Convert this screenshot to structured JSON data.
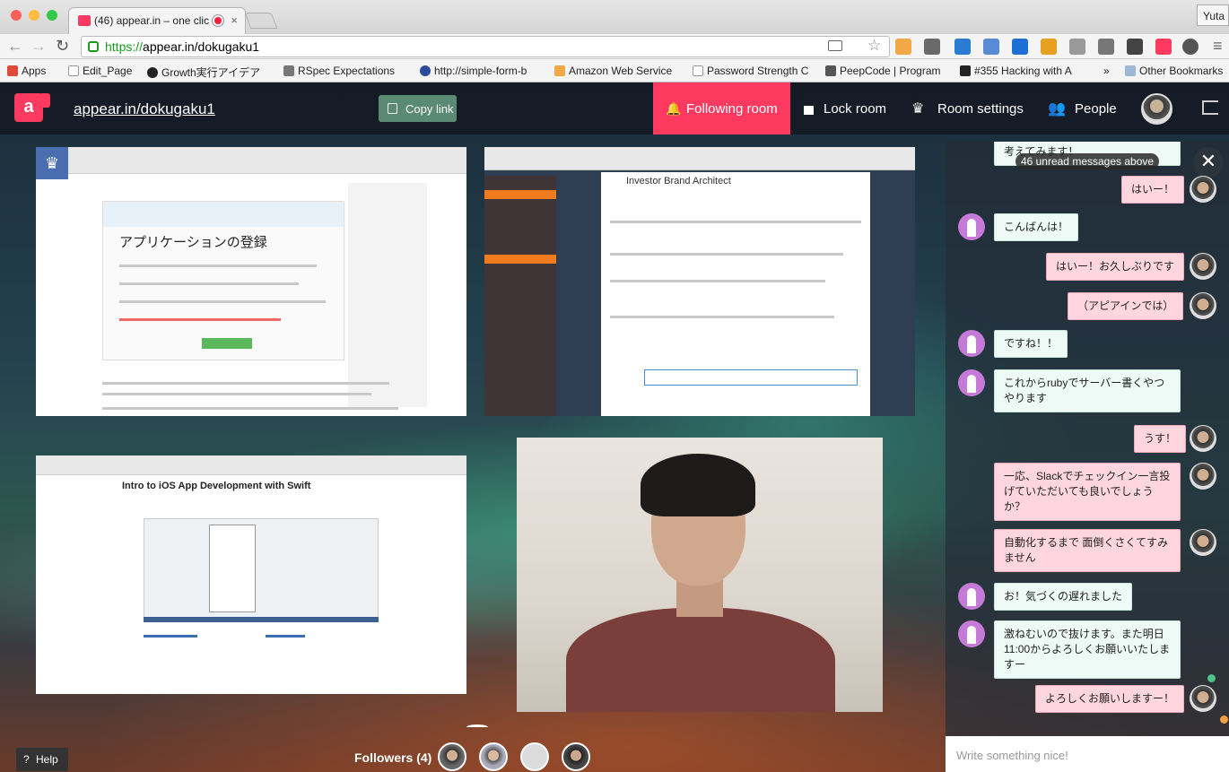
{
  "browser": {
    "tab_title": "(46) appear.in – one clic",
    "user": "Yuta",
    "url_scheme": "https://",
    "url_rest": "appear.in/dokugaku1"
  },
  "bookmarks": [
    {
      "label": "Apps",
      "icon": "apps-grid-icon"
    },
    {
      "label": "Edit_Page",
      "icon": "page-icon"
    },
    {
      "label": "Growth実行アイデア",
      "icon": "github-icon"
    },
    {
      "label": "RSpec Expectations",
      "icon": "rspec-icon"
    },
    {
      "label": "http://simple-form-b",
      "icon": "p-icon"
    },
    {
      "label": "Amazon Web Service",
      "icon": "amazon-icon"
    },
    {
      "label": "Password Strength C",
      "icon": "page-icon"
    },
    {
      "label": "PeepCode | Program",
      "icon": "peepcode-icon"
    },
    {
      "label": "#355 Hacking with A",
      "icon": "railscasts-icon"
    },
    {
      "label": "»",
      "icon": ""
    },
    {
      "label": "Other Bookmarks",
      "icon": "folder-icon"
    }
  ],
  "header": {
    "room_link": "appear.in/dokugaku1",
    "copy_link": "Copy link",
    "following_room": "Following room",
    "lock_room": "Lock room",
    "room_settings": "Room settings",
    "people": "People"
  },
  "tiles": {
    "tile1_heading": "アプリケーションの登録",
    "tile2_title": "Investor Brand Architect",
    "tile3_title": "Intro to iOS App Development with Swift"
  },
  "chat": {
    "unread": "46 unread messages above",
    "placeholder": "Write something nice!",
    "messages": [
      {
        "text": "考えてみます！",
        "dir": "in"
      },
      {
        "text": "はいー！",
        "dir": "out"
      },
      {
        "text": "こんばんは！",
        "dir": "in"
      },
      {
        "text": "はいー！お久しぶりです",
        "dir": "out"
      },
      {
        "text": "（アピアインでは）",
        "dir": "out"
      },
      {
        "text": "ですね！！",
        "dir": "in"
      },
      {
        "text": "これからrubyでサーバー書くやつやります",
        "dir": "in"
      },
      {
        "text": "うす！",
        "dir": "out"
      },
      {
        "text": "一応、Slackでチェックイン一言投げていただいても良いでしょうか？",
        "dir": "out"
      },
      {
        "text": "自動化するまで 面倒くさくてすみません",
        "dir": "out"
      },
      {
        "text": "お！気づくの遅れました",
        "dir": "in"
      },
      {
        "text": "激ねむいので抜けます。また明日11:00からよろしくお願いいたしますー",
        "dir": "in"
      },
      {
        "text": "よろしくお願いしますー！",
        "dir": "out"
      }
    ]
  },
  "footer": {
    "followers": "Followers (4)",
    "help": "Help"
  },
  "colors": {
    "brand": "#ff3a60",
    "copy_button": "#5a8a74"
  }
}
